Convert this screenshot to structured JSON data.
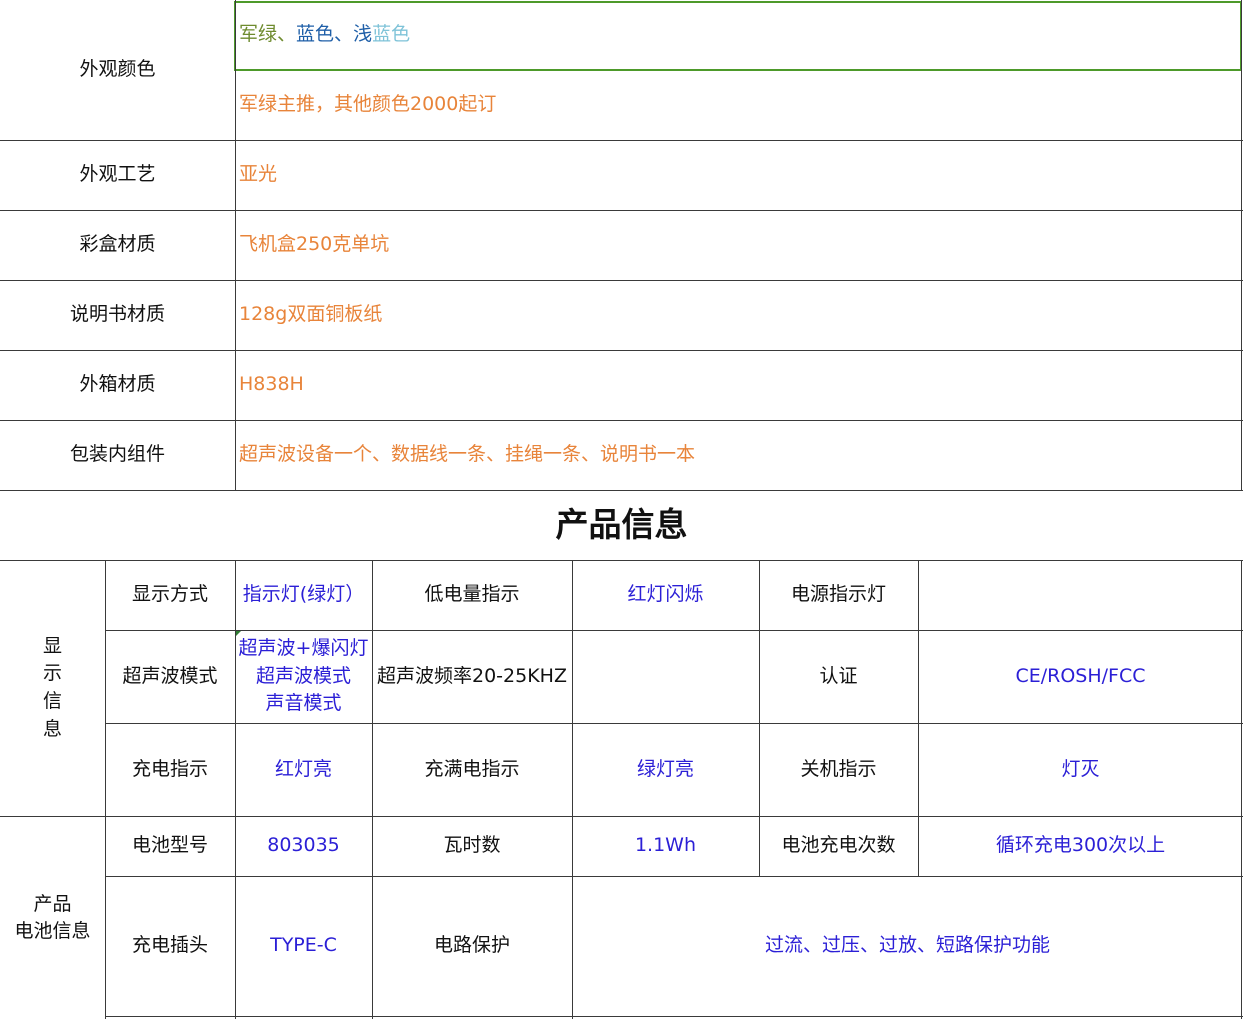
{
  "packaging": {
    "appearance_color_label": "外观颜色",
    "appearance_color_value_parts": [
      "军绿",
      "、",
      "蓝色",
      "、",
      "浅",
      "蓝色"
    ],
    "appearance_color_note": "军绿主推，其他颜色2000起订",
    "appearance_process_label": "外观工艺",
    "appearance_process_value": "亚光",
    "color_box_label": "彩盒材质",
    "color_box_value": "飞机盒250克单坑",
    "manual_label": "说明书材质",
    "manual_value": "128g双面铜板纸",
    "outer_box_label": "外箱材质",
    "outer_box_value": "H838H",
    "contents_label": "包装内组件",
    "contents_value": "超声波设备一个、数据线一条、挂绳一条、说明书一本"
  },
  "colors": {
    "army_green": "#6e8b2e",
    "blue": "#1f5fa8",
    "light_blue": "#7fc3d8",
    "orange": "#e8843a",
    "value_blue": "#2b1fd6",
    "selection_green": "#4d9a2a"
  },
  "section_title": "产品信息",
  "display_info": {
    "group_label_chars": [
      "显",
      "示",
      "信",
      "息"
    ],
    "r1": {
      "display_mode_label": "显示方式",
      "display_mode_value": "指示灯(绿灯）",
      "low_battery_label": "低电量指示",
      "low_battery_value": "红灯闪烁",
      "power_indicator_label": "电源指示灯",
      "power_indicator_value": ""
    },
    "r2": {
      "ultrasonic_mode_label": "超声波模式",
      "ultrasonic_mode_values": [
        "超声波+爆闪灯",
        "超声波模式",
        "声音模式"
      ],
      "frequency_label": "超声波频率20-25KHZ",
      "frequency_value": "",
      "certification_label": "认证",
      "certification_value": "CE/ROSH/FCC"
    },
    "r3": {
      "charging_label": "充电指示",
      "charging_value": "红灯亮",
      "full_charge_label": "充满电指示",
      "full_charge_value": "绿灯亮",
      "power_off_label": "关机指示",
      "power_off_value": "灯灭"
    }
  },
  "battery_info": {
    "group_label_lines": [
      "产品",
      "电池信息"
    ],
    "r1": {
      "battery_model_label": "电池型号",
      "battery_model_value": "803035",
      "watt_hours_label": "瓦时数",
      "watt_hours_value": "1.1Wh",
      "charge_cycles_label": "电池充电次数",
      "charge_cycles_value": "循环充电300次以上"
    },
    "r2": {
      "plug_label": "充电插头",
      "plug_value": "TYPE-C",
      "protection_label": "电路保护",
      "protection_value": "过流、过压、过放、短路保护功能"
    }
  }
}
